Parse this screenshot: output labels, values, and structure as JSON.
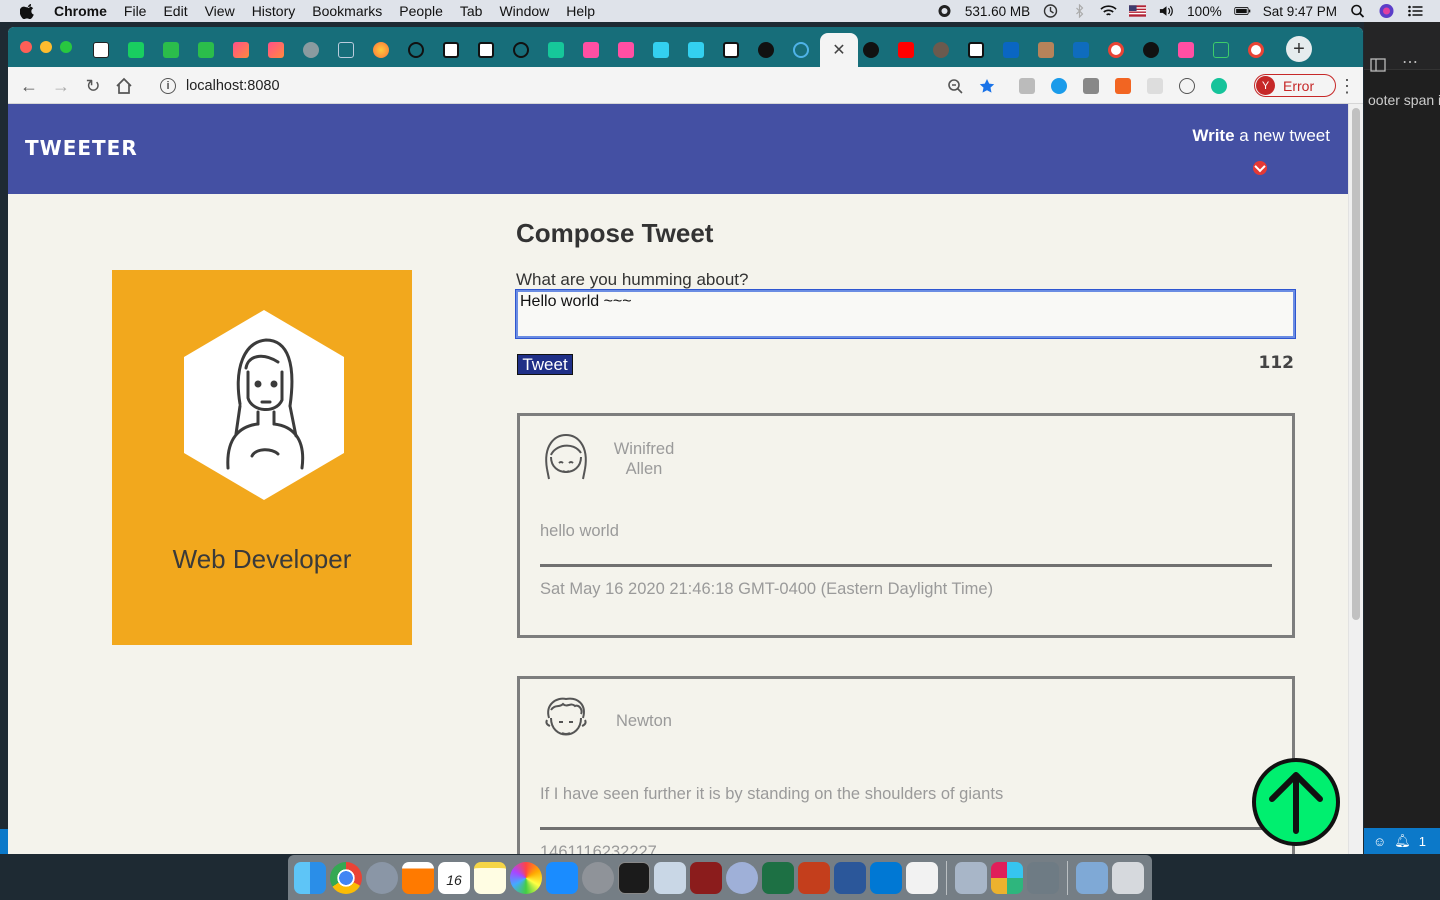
{
  "menubar": {
    "app_name": "Chrome",
    "menus": [
      "File",
      "Edit",
      "View",
      "History",
      "Bookmarks",
      "People",
      "Tab",
      "Window",
      "Help"
    ],
    "memory": "531.60 MB",
    "battery": "100%",
    "clock": "Sat 9:47 PM"
  },
  "browser": {
    "url": "localhost:8080",
    "error_badge": {
      "initial": "Y",
      "label": "Error"
    },
    "active_tab_close": "✕"
  },
  "navbar": {
    "brand": "TWEETER",
    "write_bold": "Write",
    "write_rest": " a new tweet"
  },
  "profile": {
    "title": "Web Developer",
    "card_color": "#f2a81d"
  },
  "compose": {
    "title": "Compose Tweet",
    "label": "What are you humming about?",
    "input_value": "Hello world ~~~",
    "button_label": "Tweet",
    "counter": "112"
  },
  "tweets": [
    {
      "author_first": "Winifred",
      "author_last": "Allen",
      "body": "hello world",
      "date": "Sat May 16 2020 21:46:18 GMT-0400 (Eastern Daylight Time)"
    },
    {
      "author_first": "Newton",
      "author_last": "",
      "body": "If I have seen further it is by standing on the shoulders of giants",
      "date": "1461116232227"
    }
  ],
  "editor_strip": {
    "snippet": "ooter span i",
    "notifications": "1"
  },
  "dock_calendar_day": "16",
  "colors": {
    "navbar": "#4450a3",
    "tabstrip": "#176e7a",
    "tweet_button": "#1f2f87",
    "scroll_top": "#00ef6f",
    "error": "#c62828"
  }
}
